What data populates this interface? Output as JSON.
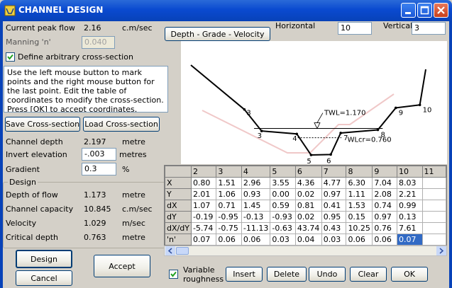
{
  "window": {
    "title": "CHANNEL DESIGN"
  },
  "left": {
    "peak_flow_label": "Current peak flow",
    "peak_flow_value": "2.16",
    "peak_flow_unit": "c.m/sec",
    "manning_label": "Manning 'n'",
    "manning_value": "0.040",
    "define_label": "Define arbitrary cross-section",
    "define_checked": true,
    "instructions": "Use the left mouse button to mark points and the right mouse button for the last point.  Edit the table of coordinates to modify the cross-section.  Press [OK] to accept coordinates.",
    "save_label": "Save Cross-section",
    "load_label": "Load Cross-section",
    "depth_label": "Channel depth",
    "depth_value": "2.197",
    "depth_unit": "metre",
    "invert_label": "Invert elevation",
    "invert_value": "-.003",
    "invert_unit": "metres",
    "gradient_label": "Gradient",
    "gradient_value": "0.3",
    "gradient_unit": "%"
  },
  "design_group": {
    "title": "Design",
    "rows": [
      {
        "label": "Depth of flow",
        "value": "1.173",
        "unit": "metre"
      },
      {
        "label": "Channel capacity",
        "value": "10.845",
        "unit": "c.m/sec"
      },
      {
        "label": "Velocity",
        "value": "1.029",
        "unit": "m/sec"
      },
      {
        "label": "Critical depth",
        "value": "0.763",
        "unit": "metre"
      }
    ]
  },
  "buttons": {
    "design": "Design",
    "cancel": "Cancel",
    "accept": "Accept",
    "dgv": "Depth  -  Grade  -  Velocity",
    "insert": "Insert",
    "delete": "Delete",
    "undo": "Undo",
    "clear": "Clear",
    "ok": "OK"
  },
  "scale": {
    "horizontal_label": "Horizontal",
    "horizontal_value": "10",
    "vertical_label": "Vertical",
    "vertical_value": "3"
  },
  "plot": {
    "twl_label": "TWL=1.170",
    "wlcr_label": "WLcr=0.760",
    "points": [
      {
        "n": "3",
        "x": 0.8,
        "y": 2.01
      },
      {
        "n": "3",
        "x": 1.51,
        "y": 1.06
      },
      {
        "n": "4",
        "x": 2.96,
        "y": 0.93
      },
      {
        "n": "5",
        "x": 3.55,
        "y": 0.0
      },
      {
        "n": "6",
        "x": 4.36,
        "y": 0.02
      },
      {
        "n": "7",
        "x": 4.77,
        "y": 0.97
      },
      {
        "n": "8",
        "x": 6.3,
        "y": 1.11
      },
      {
        "n": "9",
        "x": 7.04,
        "y": 2.08
      },
      {
        "n": "10",
        "x": 8.03,
        "y": 2.21
      }
    ]
  },
  "table": {
    "columns": [
      "2",
      "3",
      "4",
      "5",
      "6",
      "7",
      "8",
      "9",
      "10",
      "11"
    ],
    "rows": [
      {
        "label": "X",
        "cells": [
          "0.80",
          "1.51",
          "2.96",
          "3.55",
          "4.36",
          "4.77",
          "6.30",
          "7.04",
          "8.03",
          ""
        ]
      },
      {
        "label": "Y",
        "cells": [
          "2.01",
          "1.06",
          "0.93",
          "0.00",
          "0.02",
          "0.97",
          "1.11",
          "2.08",
          "2.21",
          ""
        ]
      },
      {
        "label": "dX",
        "cells": [
          "1.07",
          "0.71",
          "1.45",
          "0.59",
          "0.81",
          "0.41",
          "1.53",
          "0.74",
          "0.99",
          ""
        ]
      },
      {
        "label": "dY",
        "cells": [
          "-0.19",
          "-0.95",
          "-0.13",
          "-0.93",
          "0.02",
          "0.95",
          "0.15",
          "0.97",
          "0.13",
          ""
        ]
      },
      {
        "label": "dX/dY",
        "cells": [
          "-5.74",
          "-0.75",
          "-11.13",
          "-0.63",
          "43.74",
          "0.43",
          "10.25",
          "0.76",
          "7.61",
          ""
        ]
      },
      {
        "label": "'n'",
        "cells": [
          "0.07",
          "0.06",
          "0.06",
          "0.03",
          "0.04",
          "0.03",
          "0.06",
          "0.06",
          "0.07",
          ""
        ]
      }
    ],
    "selected": {
      "row": 5,
      "col": 8
    }
  },
  "roughness": {
    "label1": "Variable",
    "label2": "roughness",
    "checked": true
  }
}
